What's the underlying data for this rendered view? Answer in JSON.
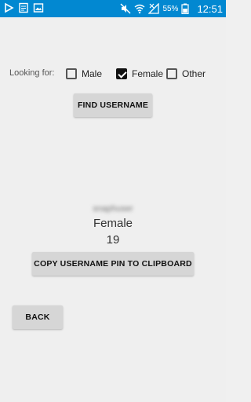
{
  "status_bar": {
    "battery_percent": "55%",
    "time": "12:51",
    "background_color": "#0288d1",
    "icons_left": [
      "play-store-icon",
      "notes-icon",
      "gallery-icon"
    ],
    "icons_right": [
      "mute-icon",
      "wifi-icon",
      "signal-icon",
      "battery-icon"
    ]
  },
  "looking_for": {
    "label": "Looking for:",
    "options": [
      {
        "label": "Male",
        "checked": false
      },
      {
        "label": "Female",
        "checked": true
      },
      {
        "label": "Other",
        "checked": false
      }
    ]
  },
  "find_button": {
    "label": "FIND USERNAME"
  },
  "result": {
    "username": "snaphuser",
    "gender": "Female",
    "age": "19"
  },
  "copy_button": {
    "label": "COPY USERNAME PIN TO CLIPBOARD"
  },
  "back_button": {
    "label": "BACK"
  }
}
